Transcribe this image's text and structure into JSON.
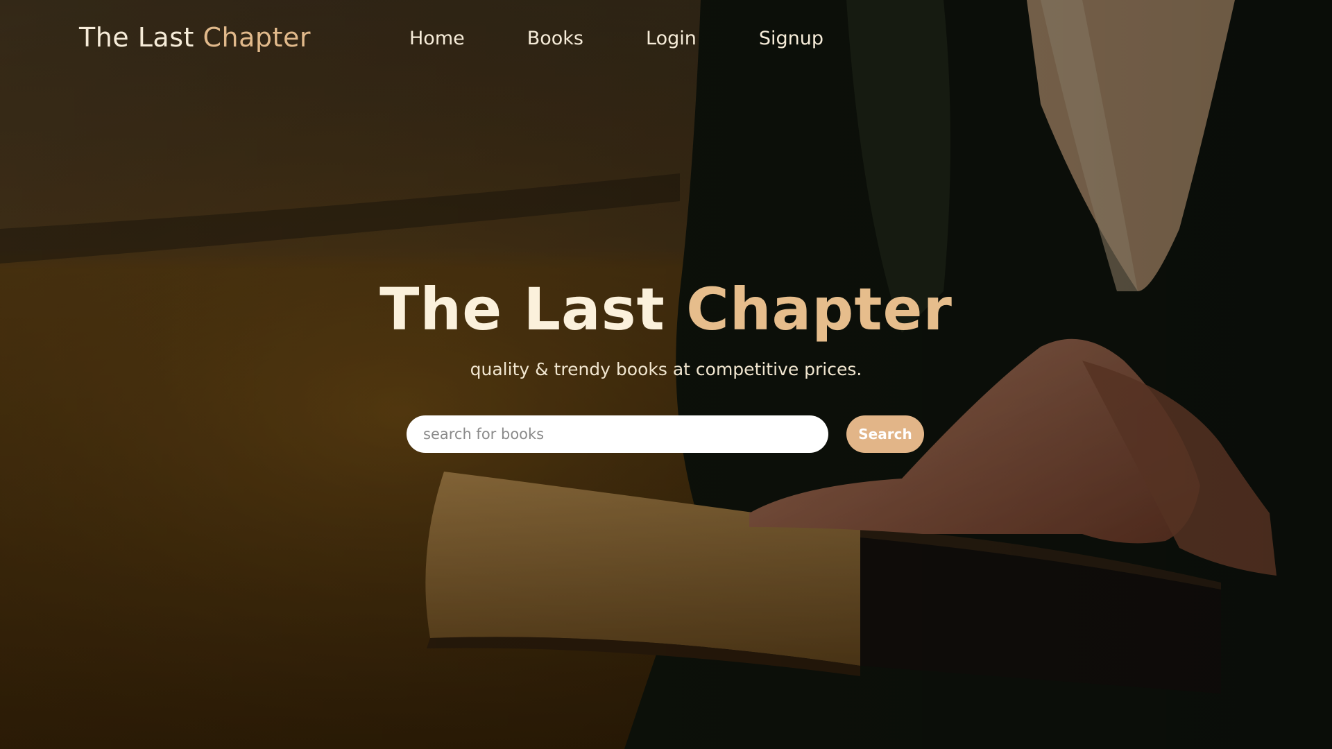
{
  "colors": {
    "accent": "#e1b98b",
    "text_light": "#f6ecd9",
    "button_bg": "#e2b588",
    "overlay_dark": "#1a1208"
  },
  "navbar": {
    "brand_part1": "The Last",
    "brand_part2": "Chapter",
    "links": [
      {
        "label": "Home"
      },
      {
        "label": "Books"
      },
      {
        "label": "Login"
      },
      {
        "label": "Signup"
      }
    ]
  },
  "hero": {
    "title_part1": "The Last",
    "title_part2": "Chapter",
    "subtitle": "quality & trendy books at competitive prices.",
    "search_placeholder": "search for books",
    "search_value": "",
    "search_button_label": "Search"
  }
}
